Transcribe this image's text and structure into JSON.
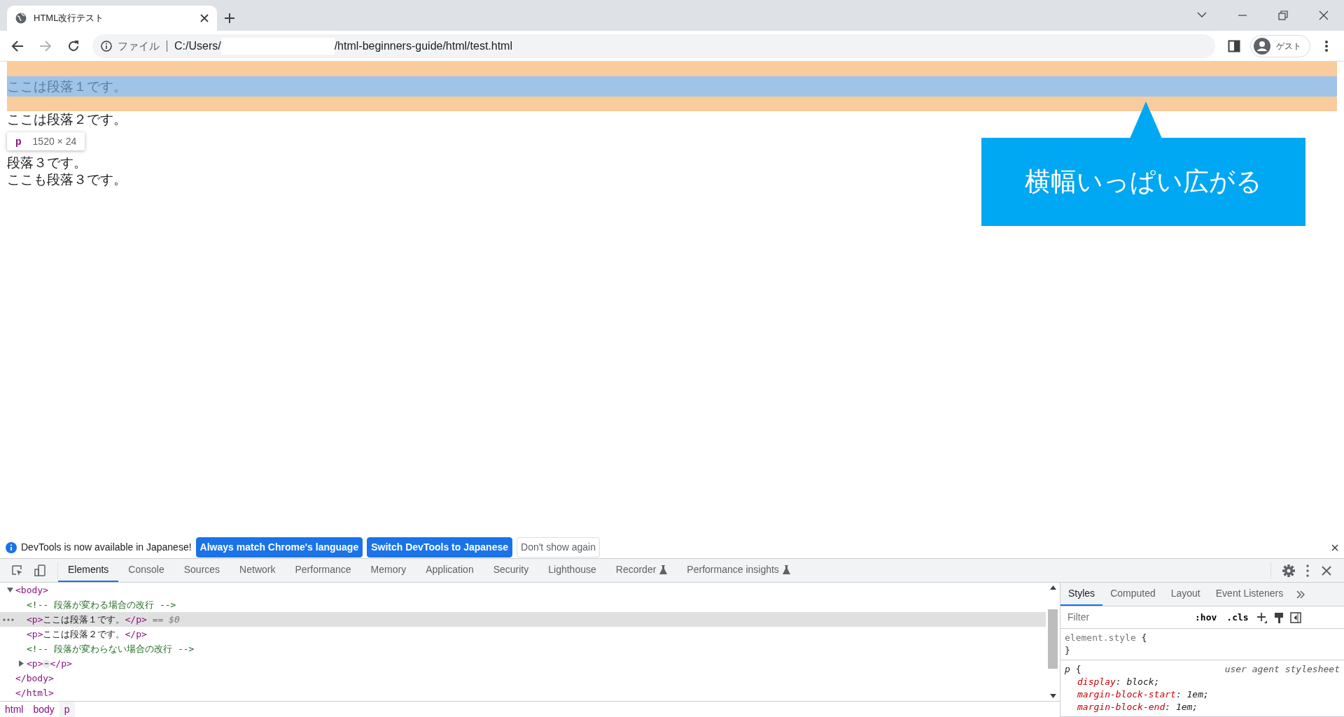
{
  "browser_tab": {
    "title": "HTML改行テスト"
  },
  "address_bar": {
    "scheme_label": "ファイル",
    "url_start": "C:/Users/",
    "url_end": "/html-beginners-guide/html/test.html"
  },
  "profile": {
    "label": "ゲスト"
  },
  "page": {
    "paragraphs": [
      {
        "text": "ここは段落１です。",
        "highlighted": true
      },
      {
        "text": "ここは段落２です。",
        "highlighted": false
      },
      {
        "text": "段落３です。",
        "highlighted": false
      },
      {
        "text": "ここも段落３です。",
        "highlighted": false
      }
    ],
    "tooltip": {
      "tag": "p",
      "size": "1520 × 24"
    },
    "callout": {
      "text": "横幅いっぱい広がる"
    }
  },
  "infobar": {
    "message": "DevTools is now available in Japanese!",
    "buttons": [
      {
        "label": "Always match Chrome's language",
        "kind": "primary"
      },
      {
        "label": "Switch DevTools to Japanese",
        "kind": "primary"
      },
      {
        "label": "Don't show again",
        "kind": "secondary"
      }
    ]
  },
  "devtools_tabs": [
    {
      "label": "Elements",
      "selected": true,
      "experimental": false
    },
    {
      "label": "Console",
      "selected": false,
      "experimental": false
    },
    {
      "label": "Sources",
      "selected": false,
      "experimental": false
    },
    {
      "label": "Network",
      "selected": false,
      "experimental": false
    },
    {
      "label": "Performance",
      "selected": false,
      "experimental": false
    },
    {
      "label": "Memory",
      "selected": false,
      "experimental": false
    },
    {
      "label": "Application",
      "selected": false,
      "experimental": false
    },
    {
      "label": "Security",
      "selected": false,
      "experimental": false
    },
    {
      "label": "Lighthouse",
      "selected": false,
      "experimental": false
    },
    {
      "label": "Recorder",
      "selected": false,
      "experimental": true
    },
    {
      "label": "Performance insights",
      "selected": false,
      "experimental": true
    }
  ],
  "dom_tree": [
    {
      "kind": "element",
      "open": "<body>",
      "close": "</body>",
      "expanded": true,
      "children": [
        {
          "kind": "comment",
          "text": "<!-- 段落が変わる場合の改行 -->",
          "selected": false
        },
        {
          "kind": "element",
          "open": "<p>",
          "content": "ここは段落１です。",
          "close": "</p>",
          "suffix": "== $0",
          "selected": true
        },
        {
          "kind": "element",
          "open": "<p>",
          "content": "ここは段落２です。",
          "close": "</p>",
          "selected": false
        },
        {
          "kind": "comment",
          "text": "<!-- 段落が変わらない場合の改行 -->",
          "selected": false
        },
        {
          "kind": "element",
          "open": "<p>",
          "ellipsis": "⋯",
          "close": "</p>",
          "expanded": false,
          "selected": false
        }
      ]
    },
    {
      "kind": "closing",
      "text": "</html>"
    }
  ],
  "breadcrumbs": [
    {
      "label": "html",
      "selected": false
    },
    {
      "label": "body",
      "selected": false
    },
    {
      "label": "p",
      "selected": true
    }
  ],
  "styles_tabs": [
    {
      "label": "Styles",
      "selected": true
    },
    {
      "label": "Computed",
      "selected": false
    },
    {
      "label": "Layout",
      "selected": false
    },
    {
      "label": "Event Listeners",
      "selected": false
    }
  ],
  "styles_filter": {
    "placeholder": "Filter",
    "hov": ":hov",
    "cls": ".cls"
  },
  "style_rules": [
    {
      "selector": "element.style",
      "open": "{",
      "close": "}"
    },
    {
      "selector": "p",
      "open": "{",
      "origin": "user agent stylesheet",
      "properties": [
        {
          "name": "display",
          "colon": ":",
          "value": "block;"
        },
        {
          "name": "margin-block-start",
          "colon": ":",
          "value": "1em;"
        },
        {
          "name": "margin-block-end",
          "colon": ":",
          "value": "1em;"
        }
      ]
    }
  ]
}
